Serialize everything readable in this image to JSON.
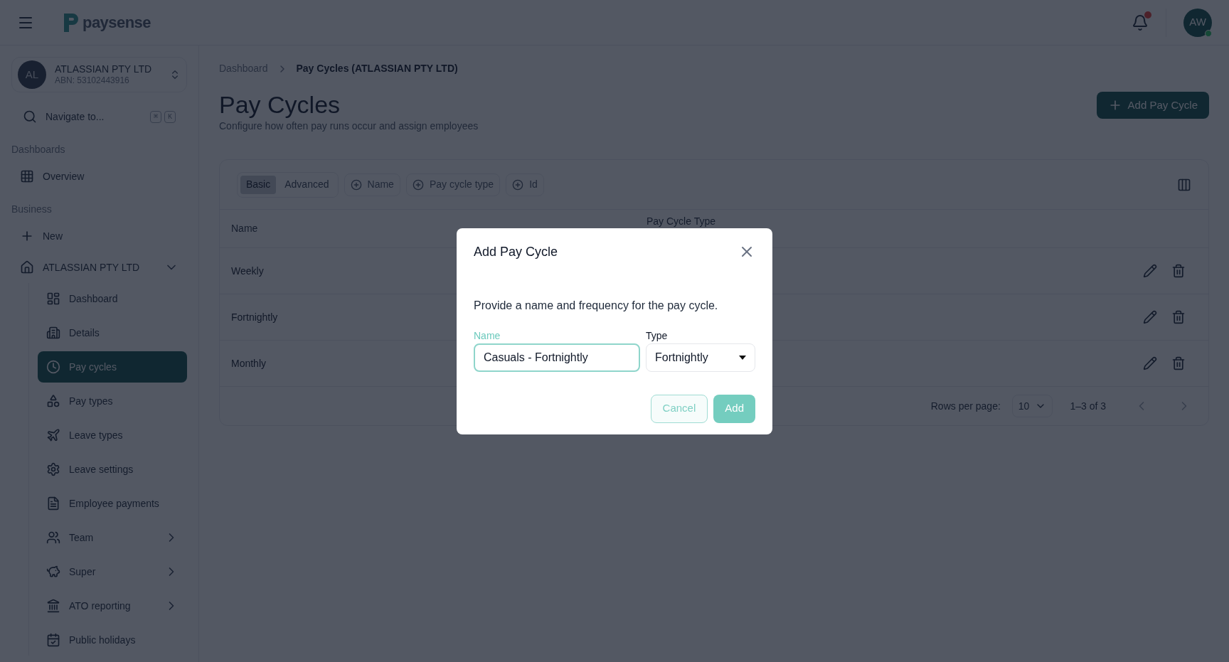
{
  "header": {
    "logo_text": "paysense",
    "notifications": {
      "unread": true
    },
    "avatar": {
      "initials": "AW",
      "online": true
    }
  },
  "org": {
    "initials": "AL",
    "name": "ATLASSIAN PTY LTD",
    "abn": "ABN: 53102443916"
  },
  "navigate": {
    "placeholder": "Navigate to...",
    "keys": [
      "⌘",
      "K"
    ]
  },
  "sections": [
    {
      "label": "Dashboards",
      "items": [
        {
          "label": "Overview",
          "selected": false
        }
      ]
    },
    {
      "label": "Business",
      "items": [
        {
          "label": "New",
          "selected": false
        },
        {
          "label": "ATLASSIAN PTY LTD",
          "selected": false,
          "expanded": true,
          "children": [
            {
              "label": "Dashboard",
              "selected": false
            },
            {
              "label": "Details",
              "selected": false
            },
            {
              "label": "Pay cycles",
              "selected": true
            },
            {
              "label": "Pay types",
              "selected": false
            },
            {
              "label": "Leave types",
              "selected": false
            },
            {
              "label": "Leave settings",
              "selected": false
            },
            {
              "label": "Employee payments",
              "selected": false
            },
            {
              "label": "Team",
              "selected": false,
              "expanded": false
            },
            {
              "label": "Super",
              "selected": false,
              "expanded": false
            },
            {
              "label": "ATO reporting",
              "selected": false,
              "expanded": false
            },
            {
              "label": "Public holidays",
              "selected": false
            }
          ]
        }
      ]
    }
  ],
  "breadcrumb": [
    {
      "label": "Dashboard",
      "current": false
    },
    {
      "label": "Pay Cycles (ATLASSIAN PTY LTD)",
      "current": true
    }
  ],
  "page": {
    "title": "Pay Cycles",
    "subtitle": "Configure how often pay runs occur and assign employees",
    "add_button": "Add Pay Cycle"
  },
  "toolbar": {
    "modes": [
      {
        "label": "Basic",
        "selected": true
      },
      {
        "label": "Advanced",
        "selected": false
      }
    ],
    "filters": [
      "Name",
      "Pay cycle type",
      "Id"
    ]
  },
  "table": {
    "columns": [
      "Name",
      "Pay Cycle Type"
    ],
    "rows": [
      {
        "name": "Weekly"
      },
      {
        "name": "Fortnightly"
      },
      {
        "name": "Monthly"
      }
    ]
  },
  "pagination": {
    "rows_per_page_label": "Rows per page:",
    "rows_per_page": "10",
    "range": "1–3 of 3"
  },
  "dialog": {
    "title": "Add Pay Cycle",
    "description": "Provide a name and frequency for the pay cycle.",
    "name_field": {
      "label": "Name",
      "value": "Casuals - Fortnightly",
      "focused": true
    },
    "type_field": {
      "label": "Type",
      "value": "Fortnightly",
      "focused": false
    },
    "buttons": [
      {
        "label": "Cancel",
        "kind": "outline"
      },
      {
        "label": "Add",
        "kind": "primary"
      }
    ]
  }
}
